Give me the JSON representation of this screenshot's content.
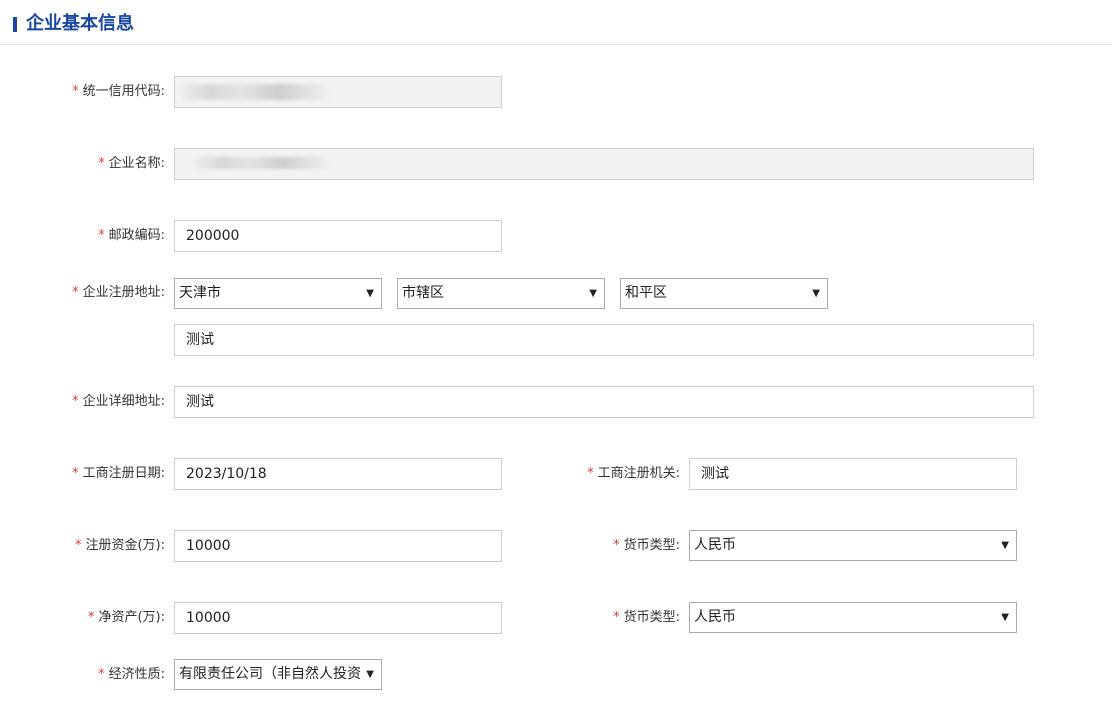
{
  "section": {
    "title": "企业基本信息"
  },
  "required_mark": "*",
  "fields": {
    "credit_code": {
      "label": "统一信用代码:",
      "value": ""
    },
    "company_name": {
      "label": "企业名称:",
      "value": ""
    },
    "postal_code": {
      "label": "邮政编码:",
      "value": "200000"
    },
    "registered_address": {
      "label": "企业注册地址:",
      "province": "天津市",
      "city": "市辖区",
      "district": "和平区",
      "street": "测试"
    },
    "detailed_address": {
      "label": "企业详细地址:",
      "value": "测试"
    },
    "registration_date": {
      "label": "工商注册日期:",
      "value": "2023/10/18"
    },
    "registration_authority": {
      "label": "工商注册机关:",
      "value": "测试"
    },
    "registered_capital": {
      "label": "注册资金(万):",
      "value": "10000"
    },
    "capital_currency": {
      "label": "货币类型:",
      "value": "人民币"
    },
    "net_assets": {
      "label": "净资产(万):",
      "value": "10000"
    },
    "assets_currency": {
      "label": "货币类型:",
      "value": "人民币"
    },
    "economic_nature": {
      "label": "经济性质:",
      "value": "有限责任公司（非自然人投资"
    }
  },
  "icons": {
    "dropdown": "▼"
  },
  "colors": {
    "accent": "#1a47a4",
    "required": "#e23b3b"
  }
}
